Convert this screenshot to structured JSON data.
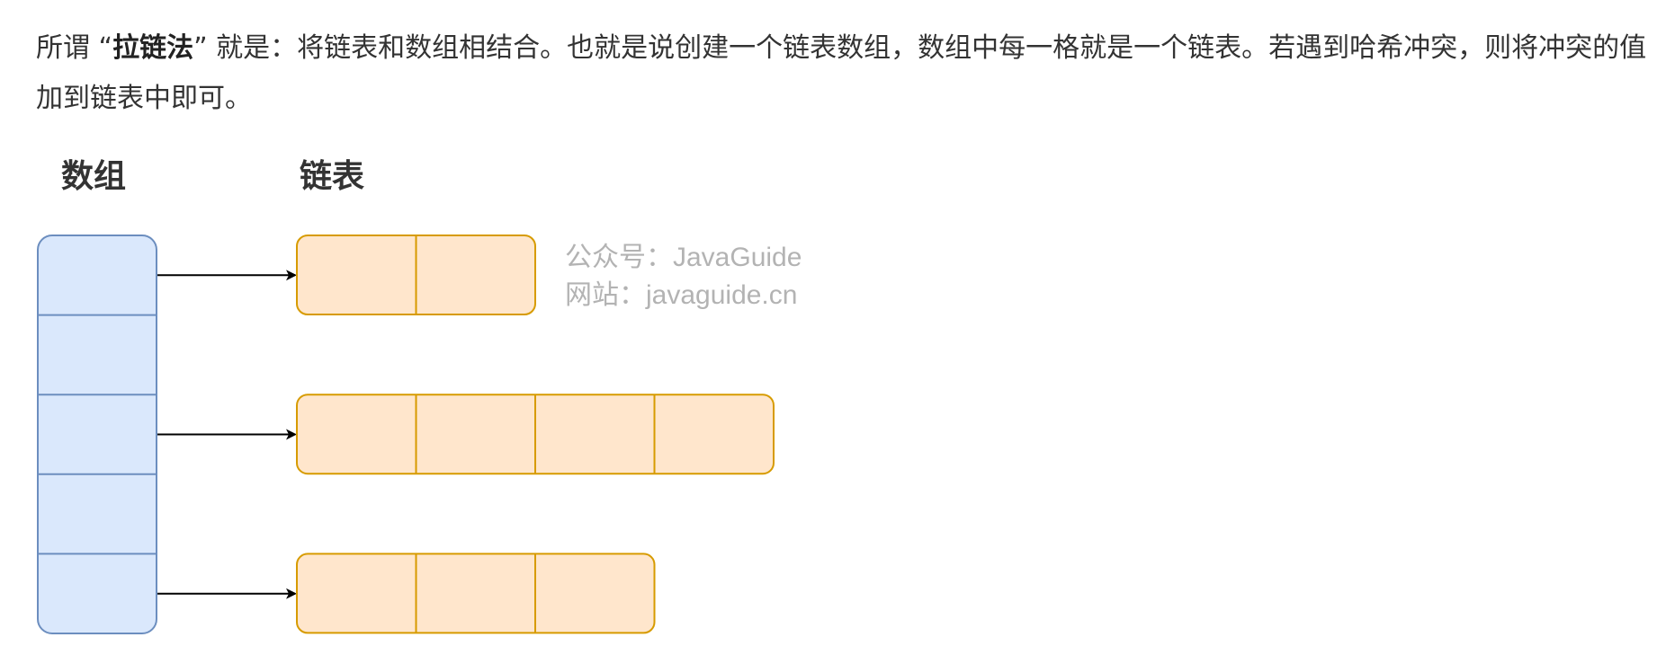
{
  "paragraph": {
    "prefix": "所谓 “",
    "bold": "拉链法",
    "suffix": "” 就是：将链表和数组相结合。也就是说创建一个链表数组，数组中每一格就是一个链表。若遇到哈希冲突，则将冲突的值加到链表中即可。"
  },
  "diagram": {
    "array_label": "数组",
    "list_label": "链表",
    "array_cells": 5,
    "chains": [
      {
        "array_index": 0,
        "nodes": 2
      },
      {
        "array_index": 2,
        "nodes": 4
      },
      {
        "array_index": 4,
        "nodes": 3
      }
    ],
    "watermark": {
      "line1": "公众号：JavaGuide",
      "line2": "网站：javaguide.cn"
    },
    "colors": {
      "array_fill": "#dae8fc",
      "array_stroke": "#6c8ebf",
      "node_fill": "#ffe6cc",
      "node_stroke": "#d79b00",
      "arrow": "#000000",
      "watermark": "#b3b3b3",
      "label": "#333333"
    }
  }
}
